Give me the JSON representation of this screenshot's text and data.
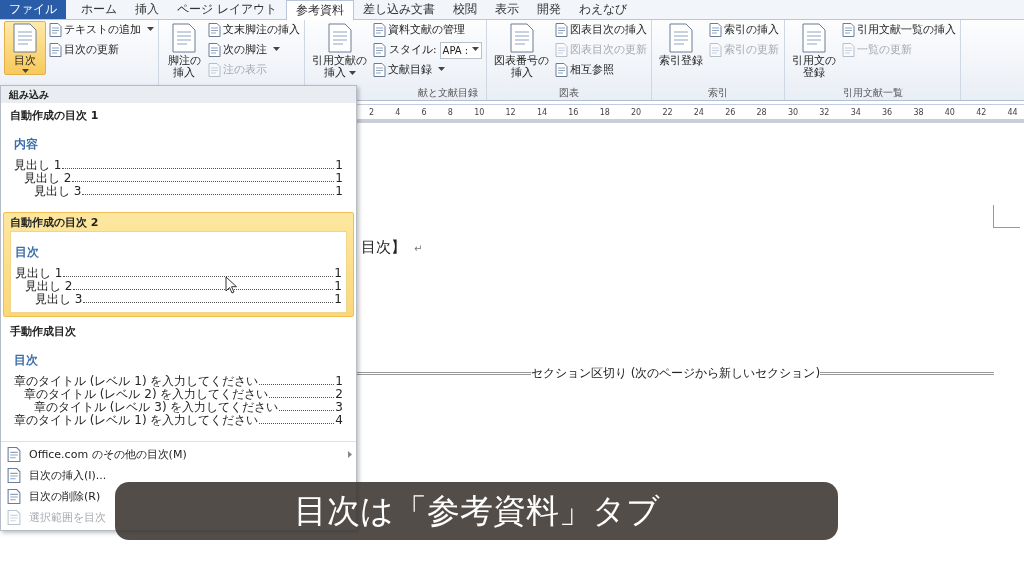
{
  "tabs": [
    {
      "label": "ファイル",
      "kind": "file",
      "selected": false
    },
    {
      "label": "ホーム",
      "kind": "tab",
      "selected": false
    },
    {
      "label": "挿入",
      "kind": "tab",
      "selected": false
    },
    {
      "label": "ページ レイアウト",
      "kind": "tab",
      "selected": false
    },
    {
      "label": "参考資料",
      "kind": "tab",
      "selected": true
    },
    {
      "label": "差し込み文書",
      "kind": "tab",
      "selected": false
    },
    {
      "label": "校閲",
      "kind": "tab",
      "selected": false
    },
    {
      "label": "表示",
      "kind": "tab",
      "selected": false
    },
    {
      "label": "開発",
      "kind": "tab",
      "selected": false
    },
    {
      "label": "わえなび",
      "kind": "tab",
      "selected": false
    }
  ],
  "ribbon": {
    "groups": [
      {
        "large": [
          {
            "label_lines": [
              "目次"
            ],
            "dropdown": true,
            "pressed": true
          }
        ],
        "small": [
          {
            "kind": "command",
            "label": "テキストの追加",
            "dropdown": true,
            "disabled": false
          },
          {
            "kind": "command",
            "label": "目次の更新",
            "dropdown": false,
            "disabled": false
          }
        ]
      },
      {
        "large": [
          {
            "label_lines": [
              "脚注の",
              "挿入"
            ],
            "dropdown": false,
            "pressed": false
          }
        ],
        "small": [
          {
            "kind": "command",
            "label": "文末脚注の挿入",
            "dropdown": false,
            "disabled": false
          },
          {
            "kind": "command",
            "label": "次の脚注",
            "dropdown": true,
            "disabled": false
          },
          {
            "kind": "command",
            "label": "注の表示",
            "dropdown": false,
            "disabled": true
          }
        ]
      },
      {
        "label": "献と文献目録",
        "large": [
          {
            "label_lines": [
              "引用文献の",
              "挿入"
            ],
            "dropdown": true,
            "pressed": false
          }
        ],
        "small": [
          {
            "kind": "command",
            "label": "資料文献の管理",
            "dropdown": false,
            "disabled": false
          },
          {
            "kind": "select",
            "label": "スタイル:",
            "value": "APA :"
          },
          {
            "kind": "command",
            "label": "文献目録",
            "dropdown": true,
            "disabled": false
          }
        ]
      },
      {
        "label": "図表",
        "large": [
          {
            "label_lines": [
              "図表番号の",
              "挿入"
            ],
            "dropdown": false,
            "pressed": false
          }
        ],
        "small": [
          {
            "kind": "command",
            "label": "図表目次の挿入",
            "dropdown": false,
            "disabled": false
          },
          {
            "kind": "command",
            "label": "図表目次の更新",
            "dropdown": false,
            "disabled": true
          },
          {
            "kind": "command",
            "label": "相互参照",
            "dropdown": false,
            "disabled": false
          }
        ]
      },
      {
        "label": "索引",
        "large": [
          {
            "label_lines": [
              "索引登録"
            ],
            "dropdown": false,
            "pressed": false
          }
        ],
        "small": [
          {
            "kind": "command",
            "label": "索引の挿入",
            "dropdown": false,
            "disabled": false
          },
          {
            "kind": "command",
            "label": "索引の更新",
            "dropdown": false,
            "disabled": true
          }
        ]
      },
      {
        "label": "引用文献一覧",
        "large": [
          {
            "label_lines": [
              "引用文の",
              "登録"
            ],
            "dropdown": false,
            "pressed": false
          }
        ],
        "small": [
          {
            "kind": "command",
            "label": "引用文献一覧の挿入",
            "dropdown": false,
            "disabled": false
          },
          {
            "kind": "command",
            "label": "一覧の更新",
            "dropdown": false,
            "disabled": true
          }
        ]
      }
    ]
  },
  "ruler": {
    "numbers": [
      "2",
      "4",
      "6",
      "8",
      "10",
      "12",
      "14",
      "16",
      "18",
      "20",
      "22",
      "24",
      "26",
      "28",
      "30",
      "32",
      "34",
      "36",
      "38",
      "40",
      "42",
      "44"
    ]
  },
  "document": {
    "heading": "目次】",
    "paragraph_mark": "↵",
    "section_break": "セクション区切り (次のページから新しいセクション)"
  },
  "dropdown": {
    "header": "組み込み",
    "items": [
      {
        "title": "自動作成の目次 1",
        "selected": false,
        "preview": {
          "heading": "内容",
          "entries": [
            {
              "text": "見出し 1",
              "page": "1",
              "children": [
                {
                  "text": "見出し 2",
                  "page": "1",
                  "children": [
                    {
                      "text": "見出し 3",
                      "page": "1"
                    }
                  ]
                }
              ]
            }
          ]
        }
      },
      {
        "title": "自動作成の目次 2",
        "selected": true,
        "preview": {
          "heading": "目次",
          "entries": [
            {
              "text": "見出し 1",
              "page": "1",
              "children": [
                {
                  "text": "見出し 2",
                  "page": "1",
                  "children": [
                    {
                      "text": "見出し 3",
                      "page": "1"
                    }
                  ]
                }
              ]
            }
          ]
        }
      },
      {
        "title": "手動作成目次",
        "selected": false,
        "preview": {
          "heading": "目次",
          "entries": [
            {
              "text": "章のタイトル (レベル 1) を入力してください",
              "page": "1",
              "children": [
                {
                  "text": "章のタイトル (レベル 2) を入力してください",
                  "page": "2",
                  "children": [
                    {
                      "text": "章のタイトル (レベル 3) を入力してください",
                      "page": "3"
                    }
                  ]
                }
              ]
            },
            {
              "text": "章のタイトル (レベル 1) を入力してください",
              "page": "4"
            }
          ]
        }
      }
    ],
    "commands": [
      {
        "label": "Office.com のその他の目次(M)",
        "disabled": false,
        "submenu": true
      },
      {
        "label": "目次の挿入(I)...",
        "disabled": false,
        "submenu": false
      },
      {
        "label": "目次の削除(R)",
        "disabled": false,
        "submenu": false
      },
      {
        "label": "選択範囲を目次",
        "disabled": true,
        "submenu": false
      }
    ]
  },
  "caption": "目次は「参考資料」タブ"
}
